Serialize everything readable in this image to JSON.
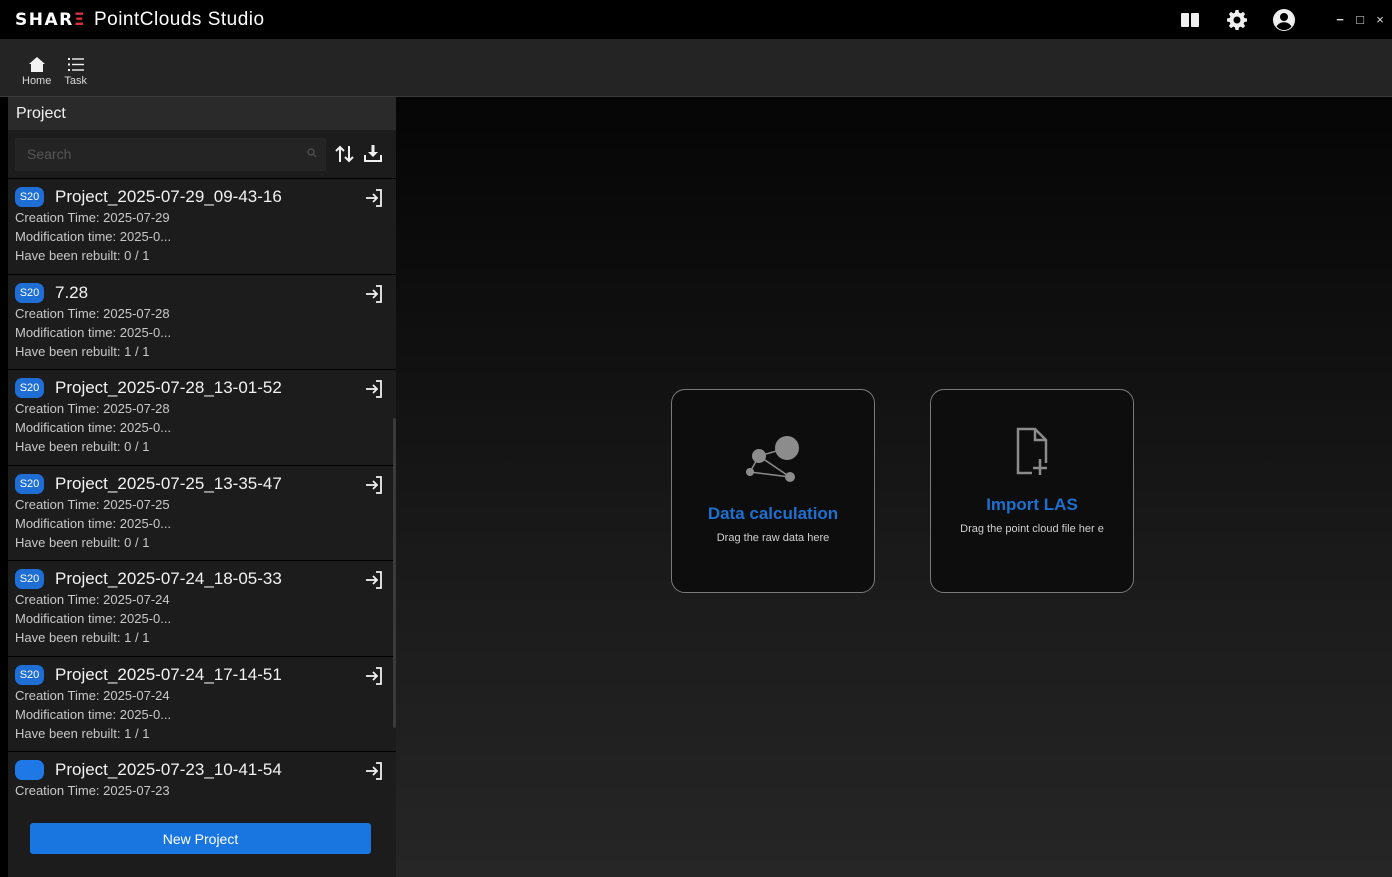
{
  "app": {
    "logo_left": "SHAR",
    "logo_right": "Ξ",
    "title": "PointClouds Studio"
  },
  "window_controls": {
    "minimize": "−",
    "maximize": "□",
    "close": "×"
  },
  "toolbar": {
    "items": [
      {
        "label": "Home",
        "icon": "home-icon"
      },
      {
        "label": "Task",
        "icon": "list-icon"
      }
    ]
  },
  "project_panel": {
    "title": "Project",
    "search_placeholder": "Search",
    "new_project_label": "New Project",
    "projects": [
      {
        "badge": "S20",
        "name": "Project_2025-07-29_09-43-16",
        "creation": "Creation Time: 2025-07-29",
        "modification": "Modification time: 2025-0...",
        "rebuilt": "Have been rebuilt: 0 / 1"
      },
      {
        "badge": "S20",
        "name": "7.28",
        "creation": "Creation Time: 2025-07-28",
        "modification": "Modification time: 2025-0...",
        "rebuilt": "Have been rebuilt: 1 / 1"
      },
      {
        "badge": "S20",
        "name": "Project_2025-07-28_13-01-52",
        "creation": "Creation Time: 2025-07-28",
        "modification": "Modification time: 2025-0...",
        "rebuilt": "Have been rebuilt: 0 / 1"
      },
      {
        "badge": "S20",
        "name": "Project_2025-07-25_13-35-47",
        "creation": "Creation Time: 2025-07-25",
        "modification": "Modification time: 2025-0...",
        "rebuilt": "Have been rebuilt: 0 / 1"
      },
      {
        "badge": "S20",
        "name": "Project_2025-07-24_18-05-33",
        "creation": "Creation Time: 2025-07-24",
        "modification": "Modification time: 2025-0...",
        "rebuilt": "Have been rebuilt: 1 / 1"
      },
      {
        "badge": "S20",
        "name": "Project_2025-07-24_17-14-51",
        "creation": "Creation Time: 2025-07-24",
        "modification": "Modification time: 2025-0...",
        "rebuilt": "Have been rebuilt: 1 / 1"
      },
      {
        "badge": "",
        "name": "Project_2025-07-23_10-41-54",
        "creation": "Creation Time: 2025-07-23",
        "modification": "",
        "rebuilt": ""
      }
    ]
  },
  "cards": {
    "data_calculation": {
      "title": "Data calculation",
      "description": "Drag the raw data here",
      "icon": "nodes-icon"
    },
    "import_las": {
      "title": "Import LAS",
      "description": "Drag the point cloud file her e",
      "icon": "file-add-icon"
    }
  },
  "colors": {
    "accent": "#1976e0",
    "card_title": "#1d6fd0",
    "badge": "#1e6ed6",
    "logo_accent": "#d8323c"
  }
}
